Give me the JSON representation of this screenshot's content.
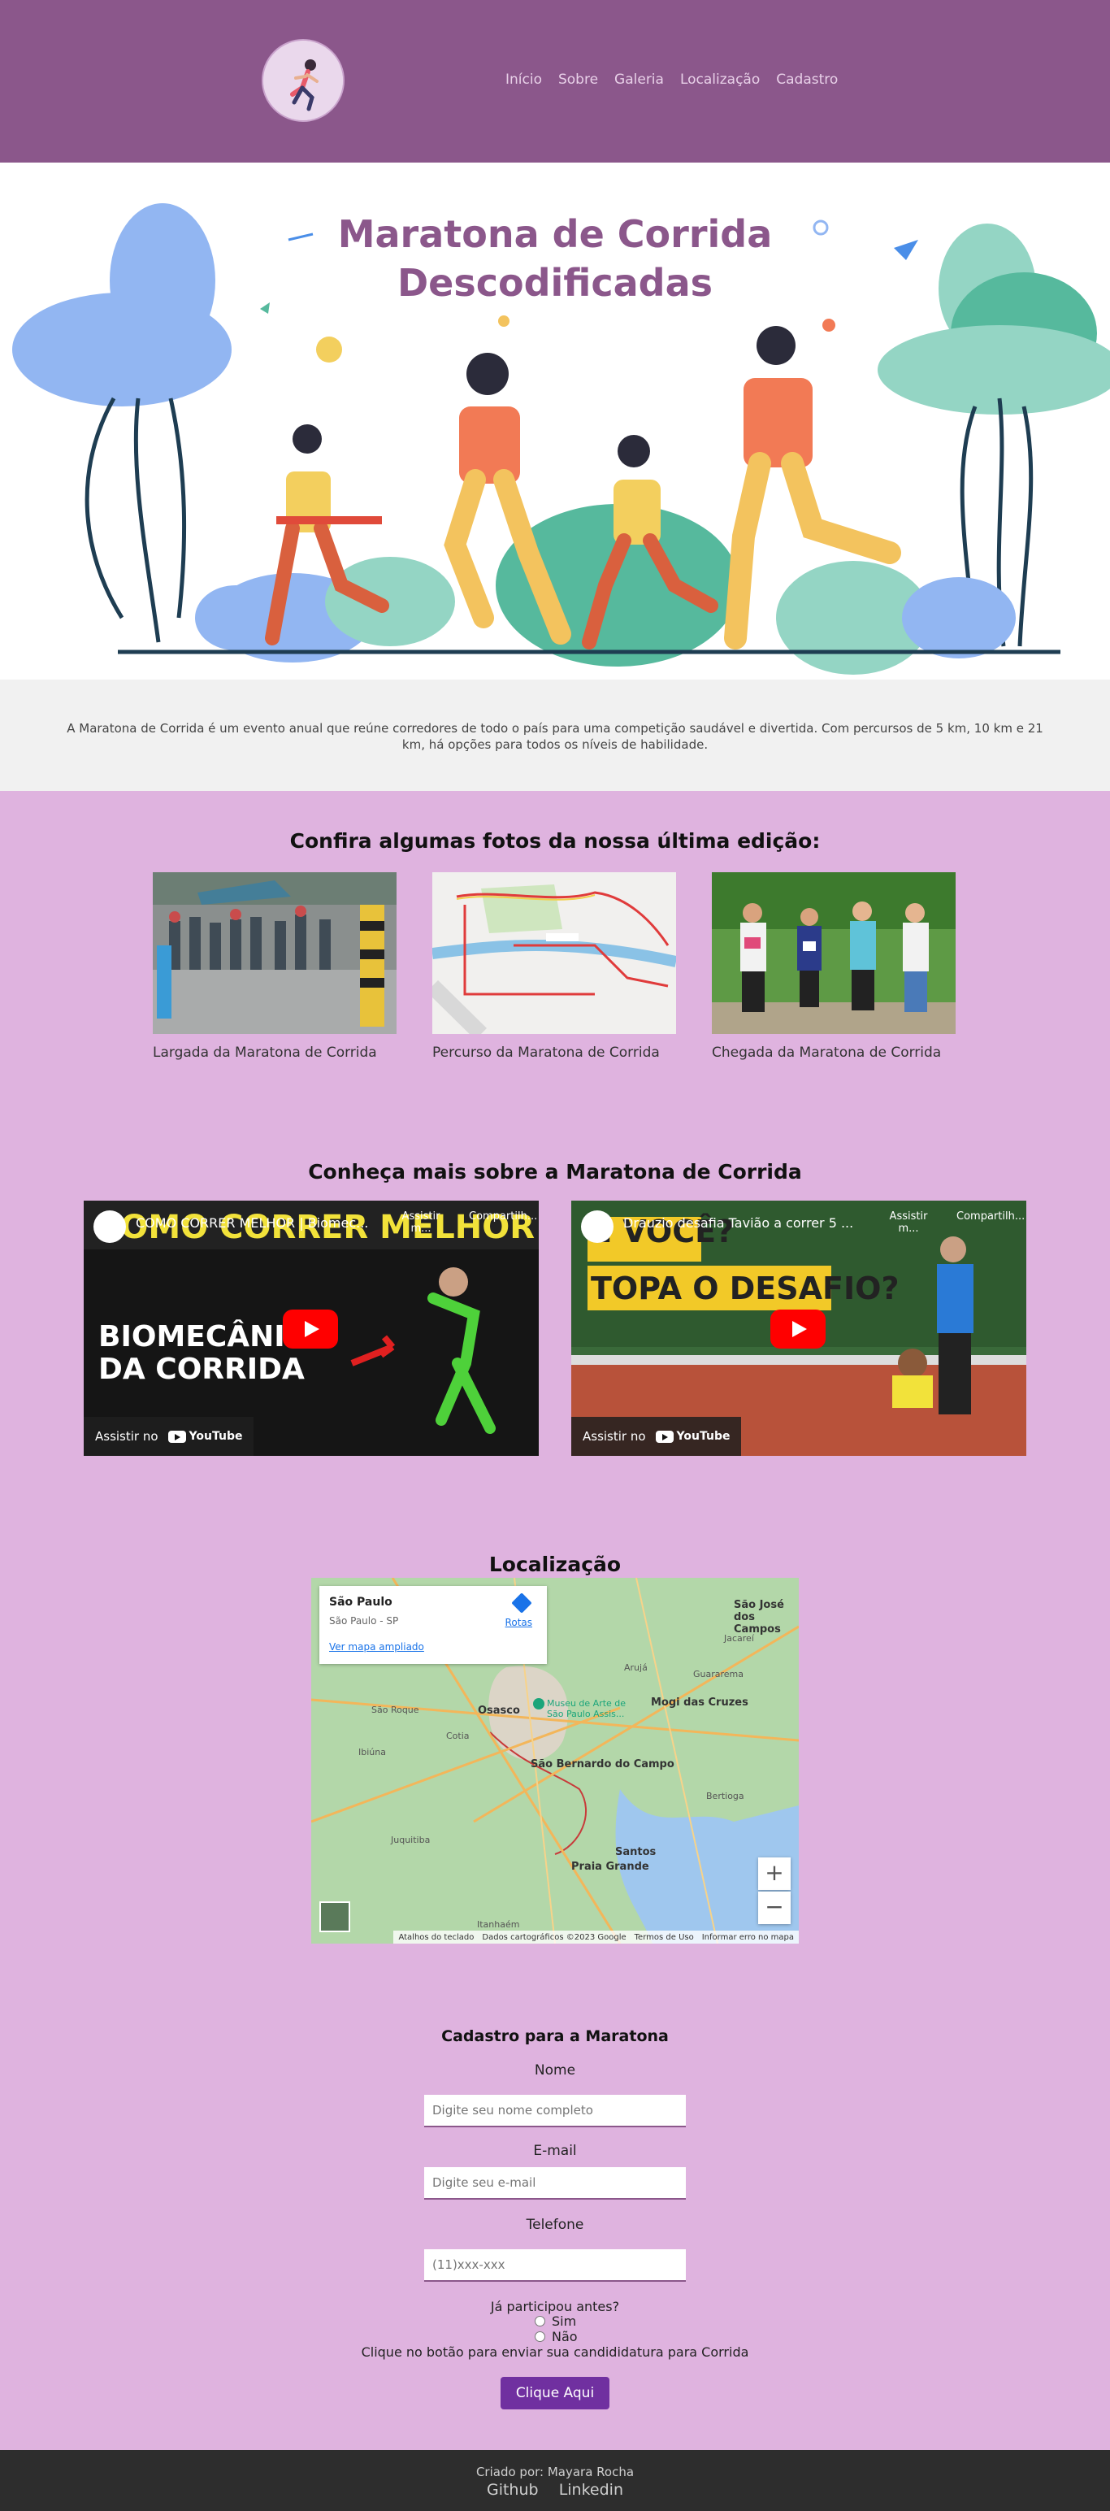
{
  "nav": {
    "items": [
      "Início",
      "Sobre",
      "Galeria",
      "Localização",
      "Cadastro"
    ]
  },
  "hero": {
    "title_line1": "Maratona de Corrida",
    "title_line2": "Descodificadas"
  },
  "intro": {
    "text": "A Maratona de Corrida é um evento anual que reúne corredores de todo o país para uma competição saudável e divertida. Com percursos de 5 km, 10 km e 21 km, há opções para todos os níveis de habilidade."
  },
  "gallery": {
    "title": "Confira algumas fotos da nossa última edição:",
    "items": [
      {
        "caption": "Largada da Maratona de Corrida"
      },
      {
        "caption": "Percurso da Maratona de Corrida"
      },
      {
        "caption": "Chegada da Maratona de Corrida"
      }
    ]
  },
  "videos": {
    "title": "Conheça mais sobre a Maratona de Corrida",
    "items": [
      {
        "title": "COMO CORRER MELHOR | Biomec...",
        "overlay_line1": "BIOMECÂNI",
        "overlay_line2": "DA CORRIDA",
        "banner": "COMO CORRER MELHOR"
      },
      {
        "title": "Drauzio desafia Tavião a correr 5 ...",
        "overlay_line1": "E VOCÊ?",
        "overlay_line2": "TOPA O DESAFIO?"
      }
    ],
    "watch_label": "Assistir no",
    "youtube_label": "YouTube",
    "watch_later": "Assistir m...",
    "share": "Compartilh..."
  },
  "map": {
    "title": "Localização",
    "place": "São Paulo",
    "place_sub": "São Paulo - SP",
    "directions": "Rotas",
    "bigger_map": "Ver mapa ampliado",
    "labels": [
      "São José dos Campos",
      "Jacareí",
      "Guararema",
      "Arujá",
      "Osasco",
      "Mogi das Cruzes",
      "São Bernardo do Campo",
      "Bertioga",
      "Santos",
      "Praia Grande",
      "Itanhaém",
      "Juquitiba",
      "Ibiúna",
      "Cotia",
      "São Roque"
    ],
    "poi": "Museu de Arte de São Paulo Assis...",
    "footer": [
      "Atalhos do teclado",
      "Dados cartográficos ©2023 Google",
      "Termos de Uso",
      "Informar erro no mapa"
    ]
  },
  "form": {
    "title": "Cadastro para a Maratona",
    "name_label": "Nome",
    "name_placeholder": "Digite seu nome completo",
    "email_label": "E-mail",
    "email_placeholder": "Digite seu e-mail",
    "phone_label": "Telefone",
    "phone_placeholder": "(11)xxx-xxx",
    "question": "Já participou antes?",
    "opt_yes": "Sim",
    "opt_no": "Não",
    "hint": "Clique no botão para enviar sua candididatura para Corrida",
    "submit": "Clique Aqui"
  },
  "footer": {
    "credit": "Criado por: Mayara Rocha",
    "github": "Github",
    "linkedin": "Linkedin"
  },
  "colors": {
    "header": "#8b578b",
    "page": "#dfb3df",
    "intro": "#f1f1f1",
    "button": "#7030a0",
    "footer": "#2d2d2d"
  }
}
